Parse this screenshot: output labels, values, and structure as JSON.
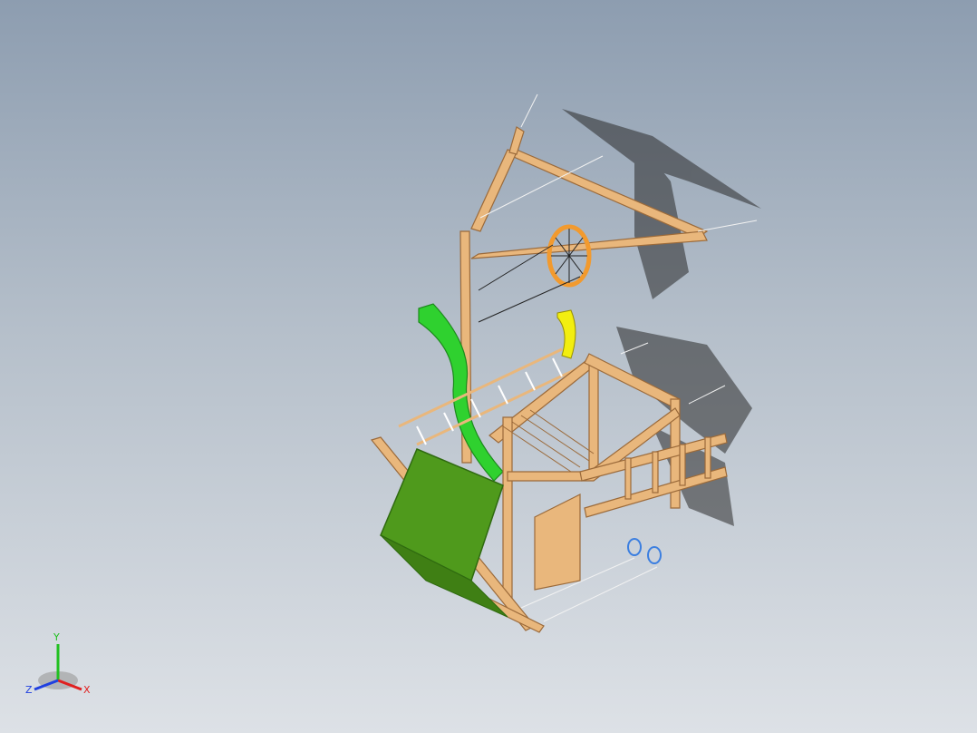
{
  "triad": {
    "x_label": "X",
    "y_label": "Y",
    "z_label": "Z",
    "colors": {
      "x": "#e02020",
      "y": "#20c020",
      "z": "#2040e0"
    }
  },
  "model": {
    "wood_color": "#e9b77c",
    "wood_edge_color": "#9b6a3a",
    "slide_color": "#4f9a1c",
    "wave_slide_color": "#2fd12f",
    "seat_color": "#f2ee10",
    "web_ring_color": "#f29a2e",
    "ring_color": "#3c7fe0",
    "rope_color": "#f2f2f2"
  }
}
